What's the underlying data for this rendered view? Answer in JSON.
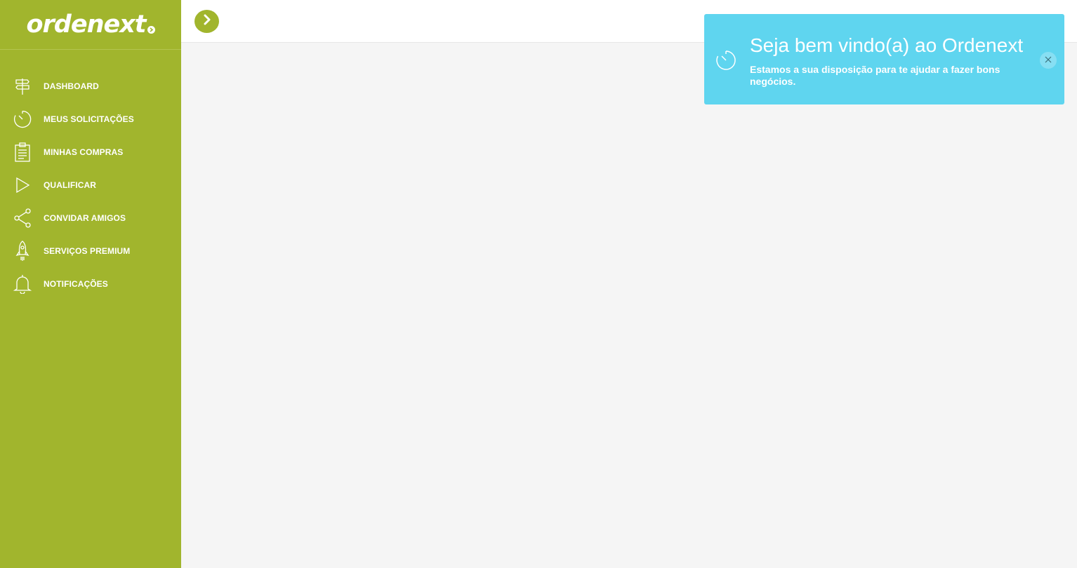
{
  "brand": {
    "logo_text": "ordenext",
    "accent_color": "#a1b52d",
    "toast_color": "#5fd5ef"
  },
  "sidebar": {
    "items": [
      {
        "label": "DASHBOARD",
        "icon": "signpost-icon"
      },
      {
        "label": "MEUS SOLICITAÇÕES",
        "icon": "stopwatch-icon"
      },
      {
        "label": "MINHAS COMPRAS",
        "icon": "clipboard-icon"
      },
      {
        "label": "QUALIFICAR",
        "icon": "play-icon"
      },
      {
        "label": "CONVIDAR AMIGOS",
        "icon": "share-icon"
      },
      {
        "label": "SERVIÇOS PREMIUM",
        "icon": "rocket-icon"
      },
      {
        "label": "NOTIFICAÇÕES",
        "icon": "bell-icon"
      }
    ]
  },
  "topbar": {
    "toggle_icon": "chevron-right-icon"
  },
  "toast": {
    "title": "Seja bem vindo(a) ao Ordenext",
    "message": "Estamos a sua disposição para te ajudar a fazer bons negócios.",
    "icon": "stopwatch-icon",
    "close_icon": "close-icon"
  }
}
